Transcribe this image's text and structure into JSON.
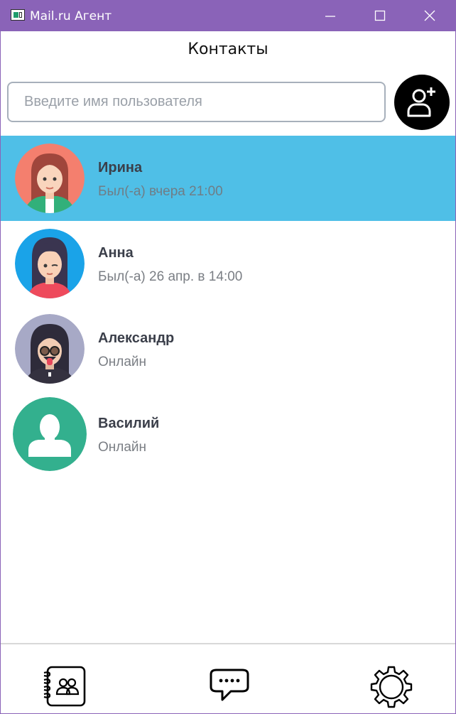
{
  "window": {
    "title": "Mail.ru Агент",
    "accent": "#8a63b8"
  },
  "header": {
    "title": "Контакты"
  },
  "search": {
    "placeholder": "Введите имя пользователя",
    "value": ""
  },
  "icons": {
    "add_contact": "add-user-icon",
    "nav_contacts": "address-book-icon",
    "nav_chats": "chat-bubble-icon",
    "nav_settings": "gear-icon"
  },
  "contacts": [
    {
      "name": "Ирина",
      "status": "Был(-а) вчера 21:00",
      "selected": true,
      "avatar_bg": "#f47f6e"
    },
    {
      "name": "Анна",
      "status": "Был(-а) 26 апр. в 14:00",
      "selected": false,
      "avatar_bg": "#1aa3e8"
    },
    {
      "name": "Александр",
      "status": "Онлайн",
      "selected": false,
      "avatar_bg": "#a7a9c6"
    },
    {
      "name": "Василий",
      "status": "Онлайн",
      "selected": false,
      "avatar_bg": "#33b08e"
    }
  ],
  "colors": {
    "selected_row": "#4fbfe7",
    "name_text": "#3b3f4a",
    "status_text": "#7a7e84"
  }
}
